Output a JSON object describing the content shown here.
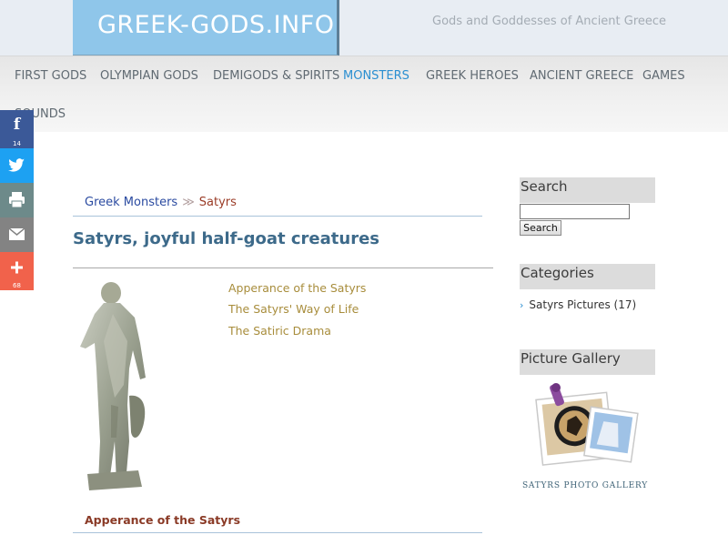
{
  "header": {
    "logo": "GREEK-GODS.INFO",
    "tagline": "Gods and Goddesses of Ancient Greece"
  },
  "nav": {
    "items": [
      {
        "label": "FIRST GODS"
      },
      {
        "label": "OLYMPIAN GODS"
      },
      {
        "label": "DEMIGODS & SPIRITS"
      },
      {
        "label": "MONSTERS",
        "active": true
      },
      {
        "label": "GREEK HEROES"
      },
      {
        "label": "ANCIENT GREECE"
      },
      {
        "label": "GAMES"
      },
      {
        "label": "SOUNDS"
      }
    ]
  },
  "share": {
    "facebook_count": "14",
    "more_count": "68",
    "icons": [
      "facebook-icon",
      "twitter-icon",
      "print-icon",
      "email-icon",
      "plus-icon"
    ]
  },
  "breadcrumb": {
    "parent": "Greek Monsters",
    "separator": "≫",
    "current": "Satyrs"
  },
  "article": {
    "title": "Satyrs, joyful half-goat creatures",
    "toc": [
      "Apperance of the Satyrs",
      "The Satyrs' Way of Life",
      "The Satiric Drama"
    ],
    "section_heading": "Apperance of the Satyrs"
  },
  "sidebar": {
    "search_title": "Search",
    "search_value": "",
    "search_button": "Search",
    "categories_title": "Categories",
    "category_item": "Satyrs Pictures (17)",
    "gallery_title": "Picture Gallery",
    "gallery_caption": "SATYRS PHOTO GALLERY"
  },
  "colors": {
    "logo_bg": "#8fc6ea",
    "nav_active": "#2b8fd1",
    "link_gold": "#a88d3c",
    "facebook": "#3b5998",
    "twitter": "#1da1f2",
    "print": "#6d8a8a",
    "email": "#838383",
    "more": "#f1624b"
  }
}
